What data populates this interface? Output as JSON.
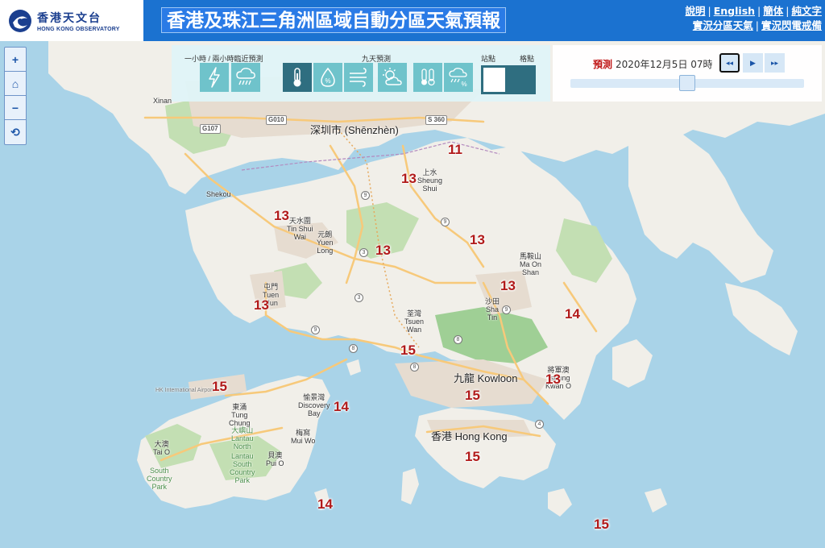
{
  "header": {
    "logo_zh": "香港天文台",
    "logo_en": "HONG KONG OBSERVATORY",
    "title": "香港及珠江三角洲區域自動分區天氣預報",
    "links_row1": [
      "說明",
      "English",
      "簡体",
      "純文字"
    ],
    "links_row2": [
      "實況分區天氣",
      "實況閃電戒備"
    ]
  },
  "zoom": {
    "buttons": [
      "+",
      "⌂",
      "−",
      "⟲"
    ]
  },
  "products": {
    "group1_label": "一小時 / 兩小時臨近預測",
    "group2_label": "九天預測",
    "station_label": "站點",
    "grid_label": "格點",
    "buttons": [
      {
        "icon": "lightning-icon",
        "active": false
      },
      {
        "icon": "rain-cloud-icon",
        "active": false
      },
      {
        "icon": "thermometer-icon",
        "active": true
      },
      {
        "icon": "humidity-icon",
        "active": false
      },
      {
        "icon": "wind-icon",
        "active": false
      },
      {
        "icon": "sun-cloud-icon",
        "active": false
      },
      {
        "icon": "max-min-temperature-icon",
        "active": false
      },
      {
        "icon": "rain-probability-icon",
        "active": false
      }
    ],
    "view_mode": "站點"
  },
  "time": {
    "label": "預測",
    "value": "2020年12月5日 07時",
    "buttons": [
      "◂◂",
      "▶",
      "▸▸"
    ],
    "slider_position_pct": 50
  },
  "map": {
    "places": [
      {
        "name": "Xinan",
        "id": "xinan"
      },
      {
        "name": "深圳市 (Shēnzhèn)",
        "id": "shenzhen"
      },
      {
        "name": "Shekou",
        "id": "shekou"
      },
      {
        "name": "上水\nSheung\nShui",
        "id": "sheung-shui"
      },
      {
        "name": "天水圍\nTin Shui\nWai",
        "id": "tin-shui-wai"
      },
      {
        "name": "元朗\nYuen\nLong",
        "id": "yuen-long"
      },
      {
        "name": "馬鞍山\nMa On\nShan",
        "id": "ma-on-shan"
      },
      {
        "name": "屯門\nTuen\nMun",
        "id": "tuen-mun"
      },
      {
        "name": "沙田\nSha\nTin",
        "id": "sha-tin"
      },
      {
        "name": "荃灣\nTsuen\nWan",
        "id": "tsuen-wan"
      },
      {
        "name": "九龍 Kowloon",
        "id": "kowloon"
      },
      {
        "name": "將軍澳\nTseung\nKwan O",
        "id": "tko"
      },
      {
        "name": "香港 Hong Kong",
        "id": "hong-kong"
      },
      {
        "name": "東涌\nTung\nChung",
        "id": "tung-chung"
      },
      {
        "name": "愉景灣\nDiscovery\nBay",
        "id": "discovery-bay"
      },
      {
        "name": "梅窩\nMui Wo",
        "id": "mui-wo"
      },
      {
        "name": "大澳\nTai O",
        "id": "tai-o"
      },
      {
        "name": "貝澳\nPui O",
        "id": "pui-o"
      },
      {
        "name": "大嶼山\nLantau\nNorth",
        "id": "lantau-north"
      },
      {
        "name": "Lantau\nSouth\nCountry\nPark",
        "id": "lantau-south"
      },
      {
        "name": "South\nCountry\nPark",
        "id": "south-country-park"
      },
      {
        "name": "HK International Airport",
        "id": "airport"
      }
    ],
    "temperatures": [
      {
        "value": "11",
        "id": "t-sheung-shui-n"
      },
      {
        "value": "13",
        "id": "t-sheung-shui"
      },
      {
        "value": "13",
        "id": "t-tin-shui-wai"
      },
      {
        "value": "13",
        "id": "t-tai-po"
      },
      {
        "value": "13",
        "id": "t-yuen-long"
      },
      {
        "value": "13",
        "id": "t-ma-on-shan"
      },
      {
        "value": "13",
        "id": "t-tuen-mun"
      },
      {
        "value": "14",
        "id": "t-sai-kung"
      },
      {
        "value": "15",
        "id": "t-tsuen-wan"
      },
      {
        "value": "13",
        "id": "t-tko"
      },
      {
        "value": "15",
        "id": "t-airport"
      },
      {
        "value": "15",
        "id": "t-kowloon"
      },
      {
        "value": "14",
        "id": "t-discovery-bay"
      },
      {
        "value": "15",
        "id": "t-hong-kong"
      },
      {
        "value": "14",
        "id": "t-lamma"
      },
      {
        "value": "15",
        "id": "t-waglan"
      }
    ],
    "road_badges": [
      "G107",
      "G010",
      "S 360"
    ],
    "road_numbers": [
      "9",
      "9",
      "3",
      "3",
      "9",
      "9",
      "8",
      "8",
      "8",
      "4"
    ]
  },
  "colors": {
    "header_bg": "#1b72d0",
    "sea": "#a9d3e8",
    "land": "#f1efe9",
    "park": "#c3dfb3",
    "urban": "#e6dcd0",
    "road": "#f7c97a",
    "temp_text": "#b11a1a",
    "panel_active": "#2f6e80",
    "panel_button": "#6fc3cb"
  }
}
